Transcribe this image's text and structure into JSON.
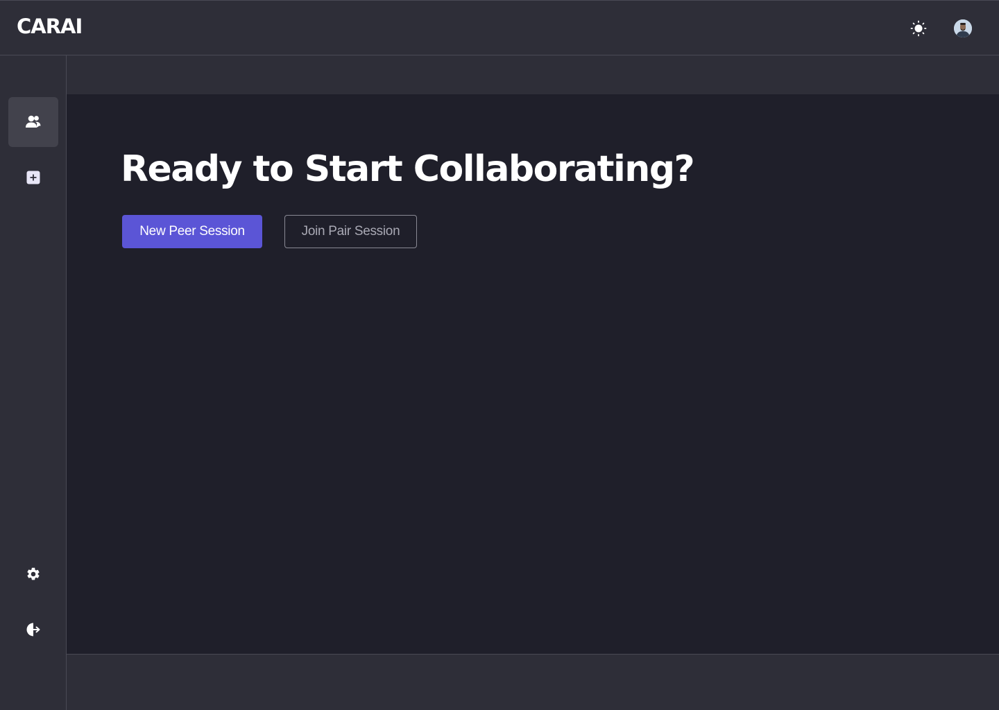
{
  "app": {
    "logo_text": "CARAI"
  },
  "header": {
    "theme_icon": "sun-icon",
    "avatar_icon": "user-avatar"
  },
  "sidebar": {
    "items": [
      {
        "icon": "users-icon",
        "active": true
      },
      {
        "icon": "plus-square-icon",
        "active": false
      }
    ],
    "bottom_items": [
      {
        "icon": "gear-icon"
      },
      {
        "icon": "logout-icon"
      }
    ]
  },
  "main": {
    "headline": "Ready to Start Collaborating?",
    "primary_button": "New Peer Session",
    "secondary_button": "Join Pair Session"
  },
  "colors": {
    "accent": "#5b55d6",
    "background": "#1f1f2a",
    "chrome": "#2e2e38"
  }
}
